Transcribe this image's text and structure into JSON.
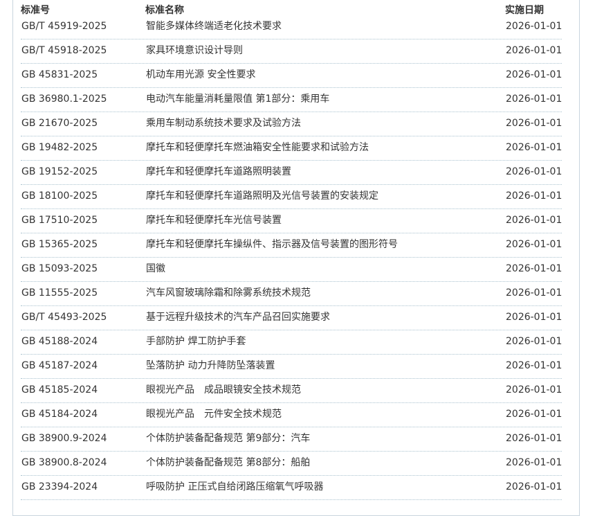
{
  "header": {
    "code": "标准号",
    "name": "标准名称",
    "date": "实施日期"
  },
  "rows": [
    {
      "code": "GB/T 45919-2025",
      "name": "智能多媒体终端适老化技术要求",
      "date": "2026-01-01"
    },
    {
      "code": "GB/T 45918-2025",
      "name": "家具环境意识设计导则",
      "date": "2026-01-01"
    },
    {
      "code": "GB 45831-2025",
      "name": "机动车用光源 安全性要求",
      "date": "2026-01-01"
    },
    {
      "code": "GB 36980.1-2025",
      "name": "电动汽车能量消耗量限值 第1部分：乘用车",
      "date": "2026-01-01"
    },
    {
      "code": "GB 21670-2025",
      "name": "乘用车制动系统技术要求及试验方法",
      "date": "2026-01-01"
    },
    {
      "code": "GB 19482-2025",
      "name": "摩托车和轻便摩托车燃油箱安全性能要求和试验方法",
      "date": "2026-01-01"
    },
    {
      "code": "GB 19152-2025",
      "name": "摩托车和轻便摩托车道路照明装置",
      "date": "2026-01-01"
    },
    {
      "code": "GB 18100-2025",
      "name": "摩托车和轻便摩托车道路照明及光信号装置的安装规定",
      "date": "2026-01-01"
    },
    {
      "code": "GB 17510-2025",
      "name": "摩托车和轻便摩托车光信号装置",
      "date": "2026-01-01"
    },
    {
      "code": "GB 15365-2025",
      "name": "摩托车和轻便摩托车操纵件、指示器及信号装置的图形符号",
      "date": "2026-01-01"
    },
    {
      "code": "GB 15093-2025",
      "name": "国徽",
      "date": "2026-01-01"
    },
    {
      "code": "GB 11555-2025",
      "name": "汽车风窗玻璃除霜和除雾系统技术规范",
      "date": "2026-01-01"
    },
    {
      "code": "GB/T 45493-2025",
      "name": "基于远程升级技术的汽车产品召回实施要求",
      "date": "2026-01-01"
    },
    {
      "code": "GB 45188-2024",
      "name": "手部防护 焊工防护手套",
      "date": "2026-01-01"
    },
    {
      "code": "GB 45187-2024",
      "name": "坠落防护 动力升降防坠落装置",
      "date": "2026-01-01"
    },
    {
      "code": "GB 45185-2024",
      "name": "眼视光产品　成品眼镜安全技术规范",
      "date": "2026-01-01"
    },
    {
      "code": "GB 45184-2024",
      "name": "眼视光产品　元件安全技术规范",
      "date": "2026-01-01"
    },
    {
      "code": "GB 38900.9-2024",
      "name": "个体防护装备配备规范 第9部分：汽车",
      "date": "2026-01-01"
    },
    {
      "code": "GB 38900.8-2024",
      "name": "个体防护装备配备规范 第8部分：船舶",
      "date": "2026-01-01"
    },
    {
      "code": "GB 23394-2024",
      "name": "呼吸防护 正压式自给闭路压缩氧气呼吸器",
      "date": "2026-01-01"
    }
  ]
}
